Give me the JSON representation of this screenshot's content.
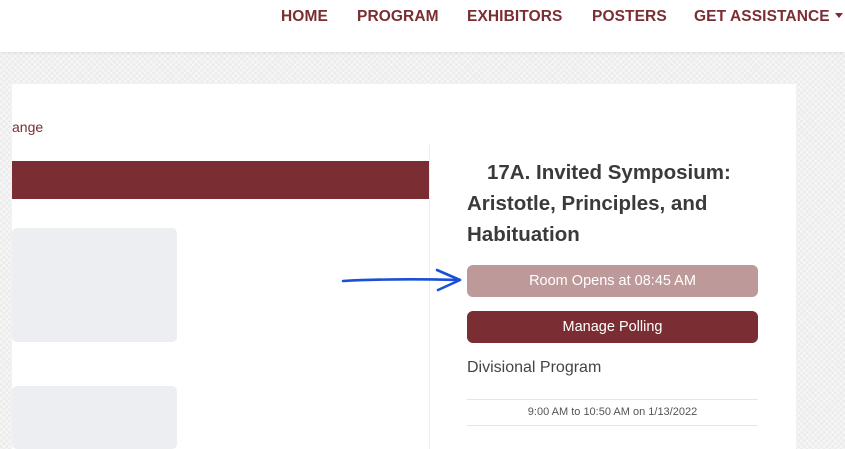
{
  "nav": {
    "items": [
      {
        "label": "HOME"
      },
      {
        "label": "PROGRAM"
      },
      {
        "label": "EXHIBITORS"
      },
      {
        "label": "POSTERS"
      },
      {
        "label": "GET ASSISTANCE"
      }
    ]
  },
  "breadcrumb": {
    "text": "ange"
  },
  "session": {
    "title_line1": "17A. Invited Symposium:",
    "title_line2": "Aristotle, Principles, and",
    "title_line3": "Habituation",
    "room_button": "Room Opens at 08:45 AM",
    "polling_button": "Manage Polling",
    "division": "Divisional Program",
    "time": "9:00 AM to 10:50 AM on 1/13/2022"
  },
  "colors": {
    "brand": "#7a2e33",
    "room_button": "#bd999a",
    "arrow": "#1a4fd6"
  },
  "icons": {
    "annotation": "arrow-right-icon",
    "dropdown": "caret-down-icon"
  }
}
